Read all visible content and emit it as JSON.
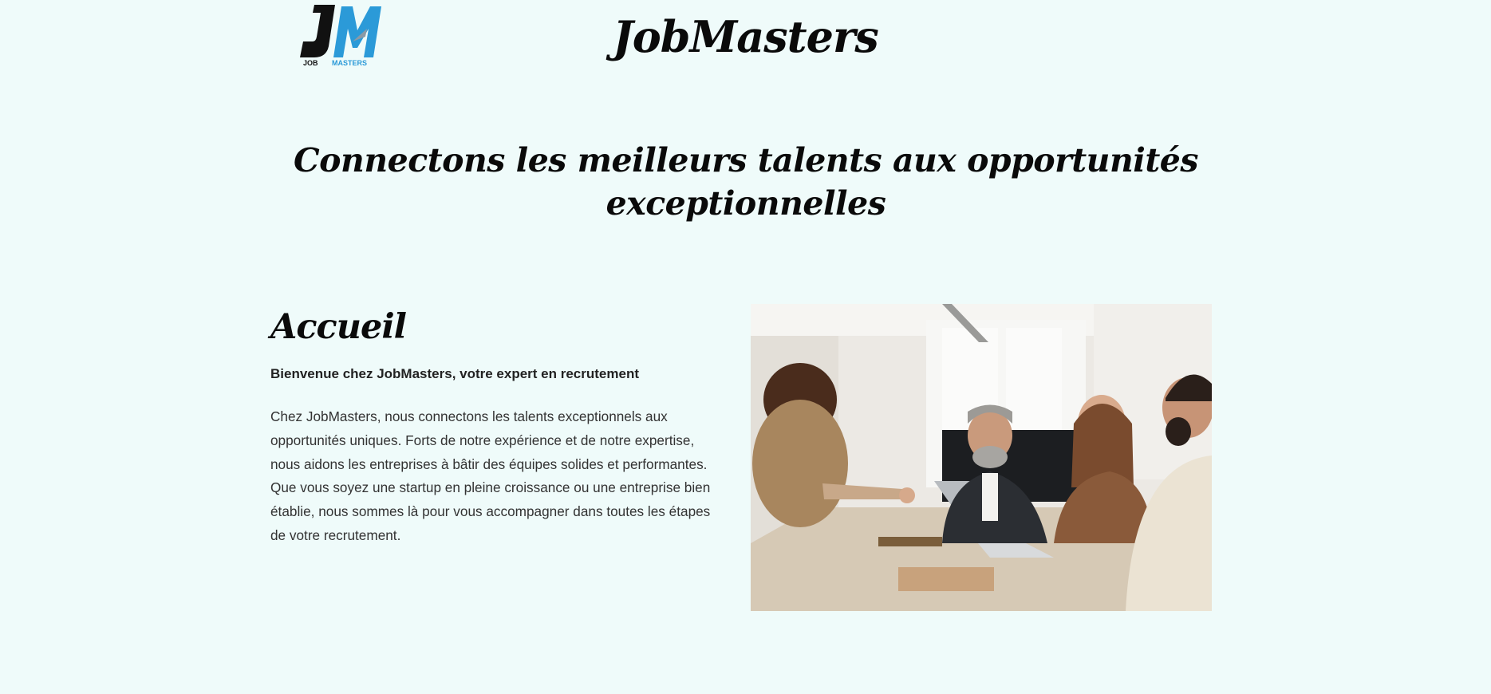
{
  "header": {
    "logo": {
      "monogram": "JM",
      "word_left": "JOB",
      "word_right": "MASTERS",
      "colors": {
        "dark": "#111111",
        "blue": "#2b9ad8"
      }
    },
    "site_title": "JobMasters"
  },
  "hero": {
    "tagline": "Connectons les meilleurs talents aux opportunités exceptionnelles"
  },
  "home": {
    "heading": "Accueil",
    "intro": "Bienvenue chez JobMasters, votre expert en recrutement",
    "body": "Chez JobMasters, nous connectons les talents exceptionnels aux opportunités uniques. Forts de notre expérience et de notre expertise, nous aidons les entreprises à bâtir des équipes solides et performantes. Que vous soyez une startup en pleine croissance ou une entreprise bien établie, nous sommes là pour vous accompagner dans toutes les étapes de votre recrutement.",
    "photo_subject": "meeting-handshake-photo"
  },
  "theme": {
    "background": "#effbfa",
    "text": "#0a0a0a"
  }
}
